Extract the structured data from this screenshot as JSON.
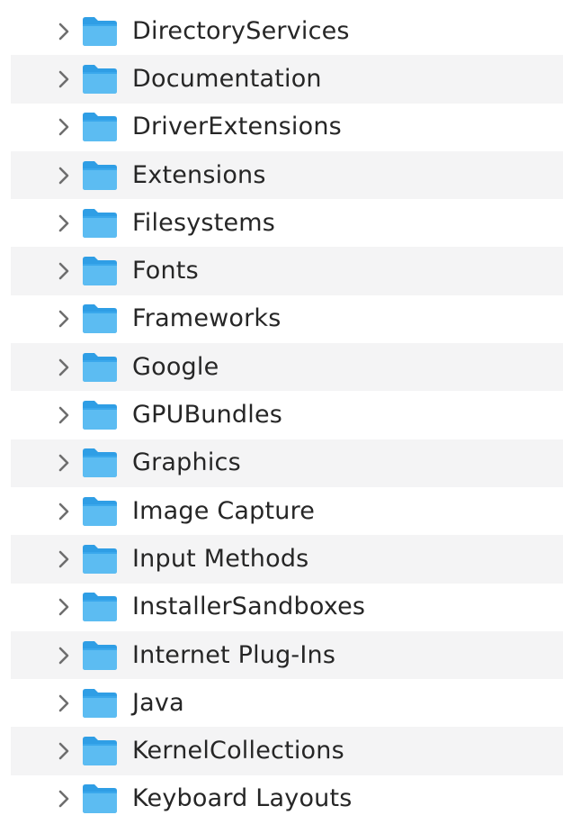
{
  "finder_list": {
    "items": [
      {
        "label": "DirectoryServices",
        "icon": "folder-icon"
      },
      {
        "label": "Documentation",
        "icon": "folder-icon"
      },
      {
        "label": "DriverExtensions",
        "icon": "folder-icon"
      },
      {
        "label": "Extensions",
        "icon": "folder-icon"
      },
      {
        "label": "Filesystems",
        "icon": "folder-icon"
      },
      {
        "label": "Fonts",
        "icon": "folder-icon"
      },
      {
        "label": "Frameworks",
        "icon": "folder-icon"
      },
      {
        "label": "Google",
        "icon": "folder-icon"
      },
      {
        "label": "GPUBundles",
        "icon": "folder-icon"
      },
      {
        "label": "Graphics",
        "icon": "folder-icon"
      },
      {
        "label": "Image Capture",
        "icon": "folder-icon"
      },
      {
        "label": "Input Methods",
        "icon": "folder-icon"
      },
      {
        "label": "InstallerSandboxes",
        "icon": "folder-icon"
      },
      {
        "label": "Internet Plug-Ins",
        "icon": "folder-icon"
      },
      {
        "label": "Java",
        "icon": "folder-icon"
      },
      {
        "label": "KernelCollections",
        "icon": "folder-icon"
      },
      {
        "label": "Keyboard Layouts",
        "icon": "folder-icon"
      }
    ],
    "colors": {
      "folder_body": "#2f9ee5",
      "folder_top": "#5cbcf2",
      "stripe": "#f4f4f5",
      "text": "#262626",
      "chevron": "#6e6e6e"
    }
  }
}
